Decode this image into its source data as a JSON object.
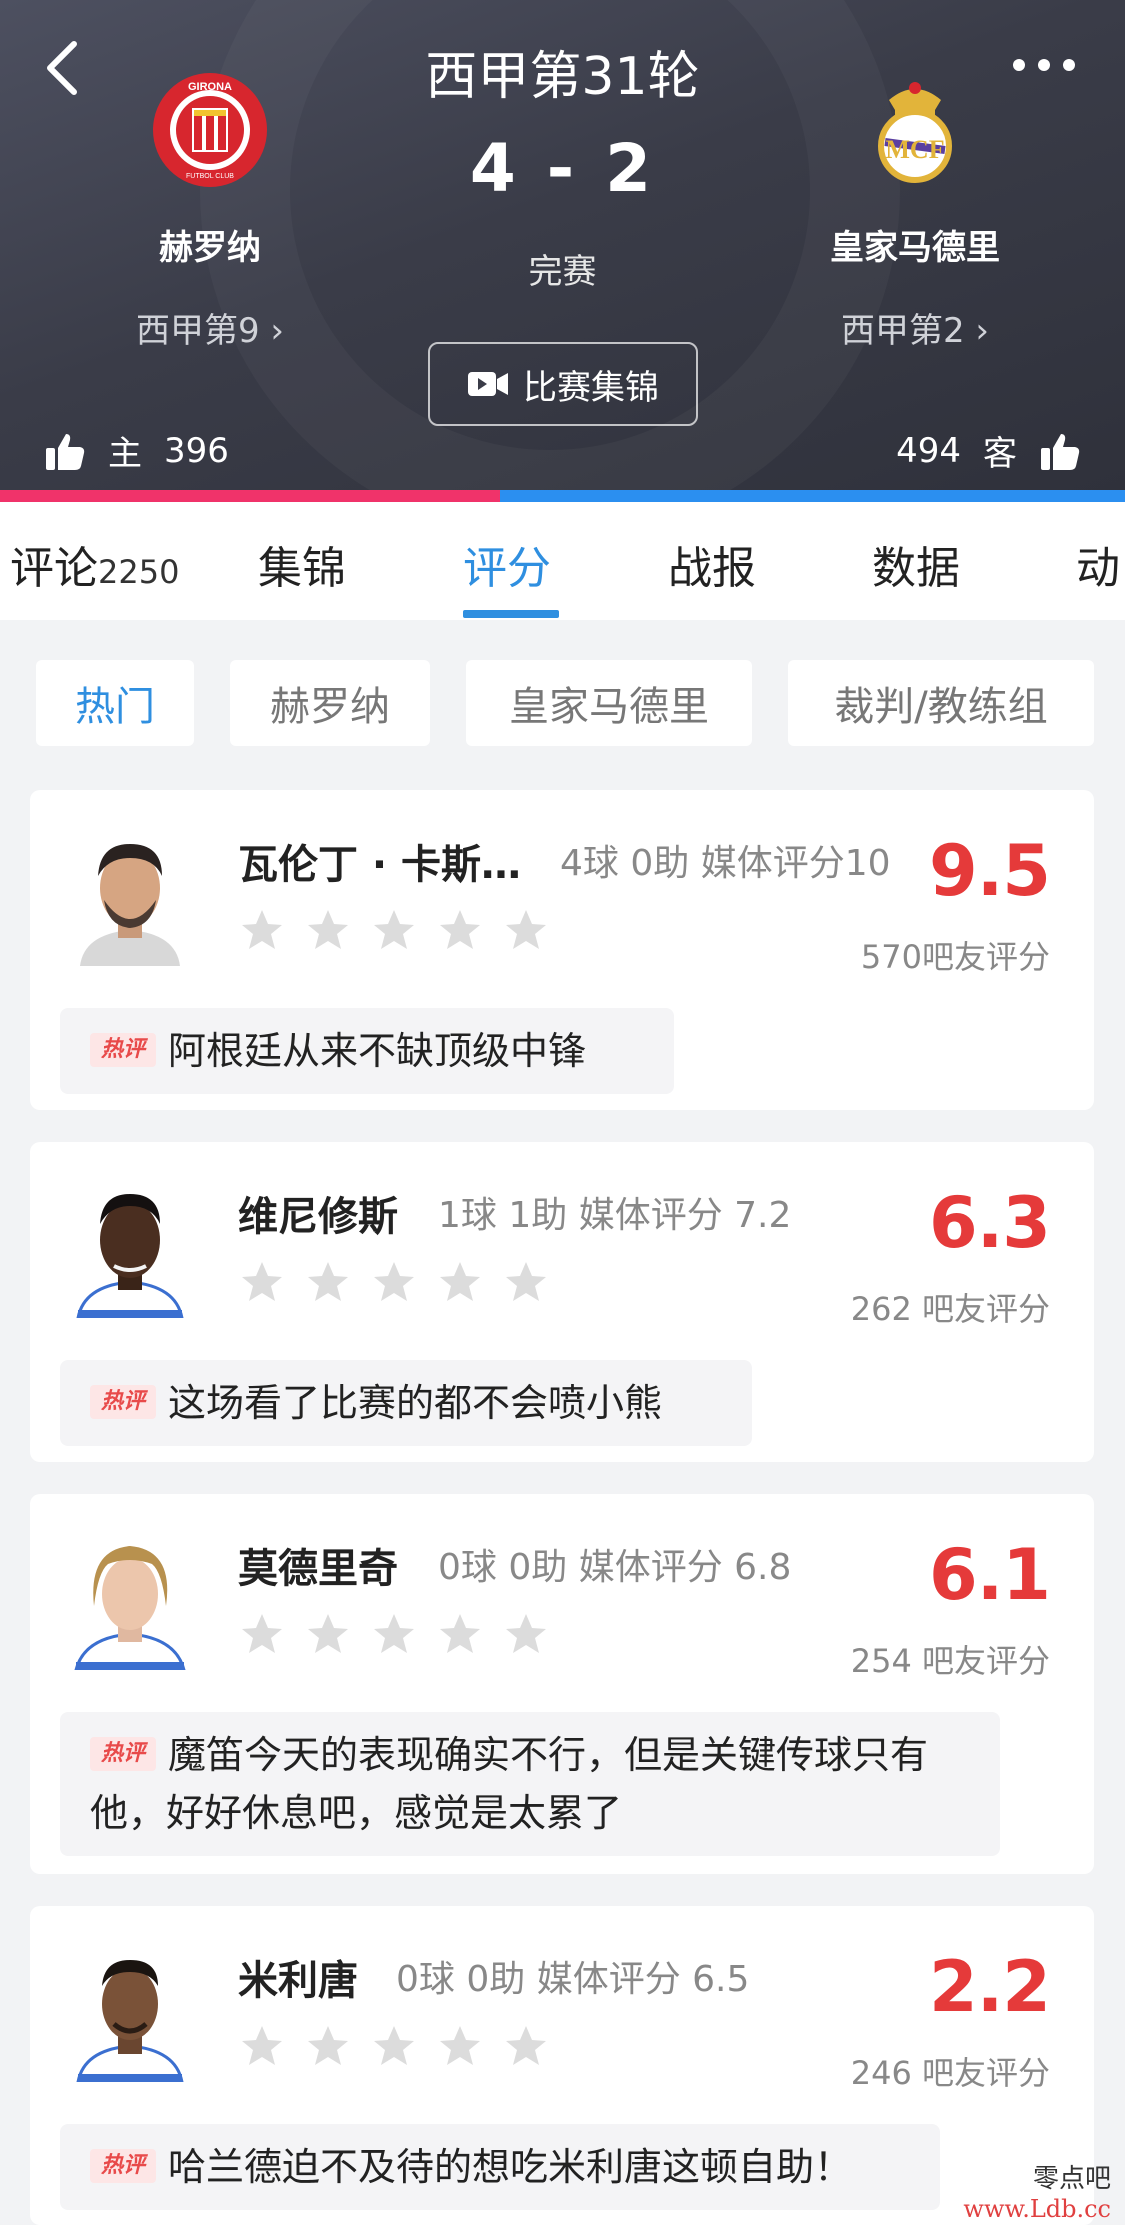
{
  "header": {
    "round_title": "西甲第31轮",
    "score": "4 - 2",
    "status": "完赛",
    "highlight_button": "比赛集锦",
    "home": {
      "name": "赫罗纳",
      "rank": "西甲第9",
      "likes_label": "主",
      "likes": "396",
      "logo_text": "GIRONA FUTBOL CLUB"
    },
    "away": {
      "name": "皇家马德里",
      "rank": "西甲第2",
      "likes_label": "客",
      "likes": "494"
    },
    "colors": {
      "home": "#f0336a",
      "away": "#2b8ff0"
    }
  },
  "tabs": [
    {
      "label": "评论",
      "count": "2250"
    },
    {
      "label": "集锦"
    },
    {
      "label": "评分"
    },
    {
      "label": "战报"
    },
    {
      "label": "数据"
    },
    {
      "label": "动"
    }
  ],
  "filters": [
    "热门",
    "赫罗纳",
    "皇家马德里",
    "裁判/教练组"
  ],
  "hot_tag": "热评",
  "players": [
    {
      "name": "瓦伦丁 · 卡斯…",
      "stats": "4球 0助 媒体评分10",
      "rating": "9.5",
      "fans": "570吧友评分",
      "comment": "阿根廷从来不缺顶级中锋"
    },
    {
      "name": "维尼修斯",
      "stats": "1球 1助 媒体评分 7.2",
      "rating": "6.3",
      "fans": "262 吧友评分",
      "comment": "这场看了比赛的都不会喷小熊"
    },
    {
      "name": "莫德里奇",
      "stats": "0球 0助 媒体评分 6.8",
      "rating": "6.1",
      "fans": "254 吧友评分",
      "comment": "魔笛今天的表现确实不行，但是关键传球只有他，好好休息吧，感觉是太累了"
    },
    {
      "name": "米利唐",
      "stats": "0球 0助 媒体评分 6.5",
      "rating": "2.2",
      "fans": "246 吧友评分",
      "comment": "哈兰德迫不及待的想吃米利唐这顿自助！"
    }
  ],
  "watermark": {
    "line1": "零点吧",
    "line2": "www.Ldb.cc"
  },
  "accent": "#2f8fe0",
  "rating_color": "#e53a3a"
}
